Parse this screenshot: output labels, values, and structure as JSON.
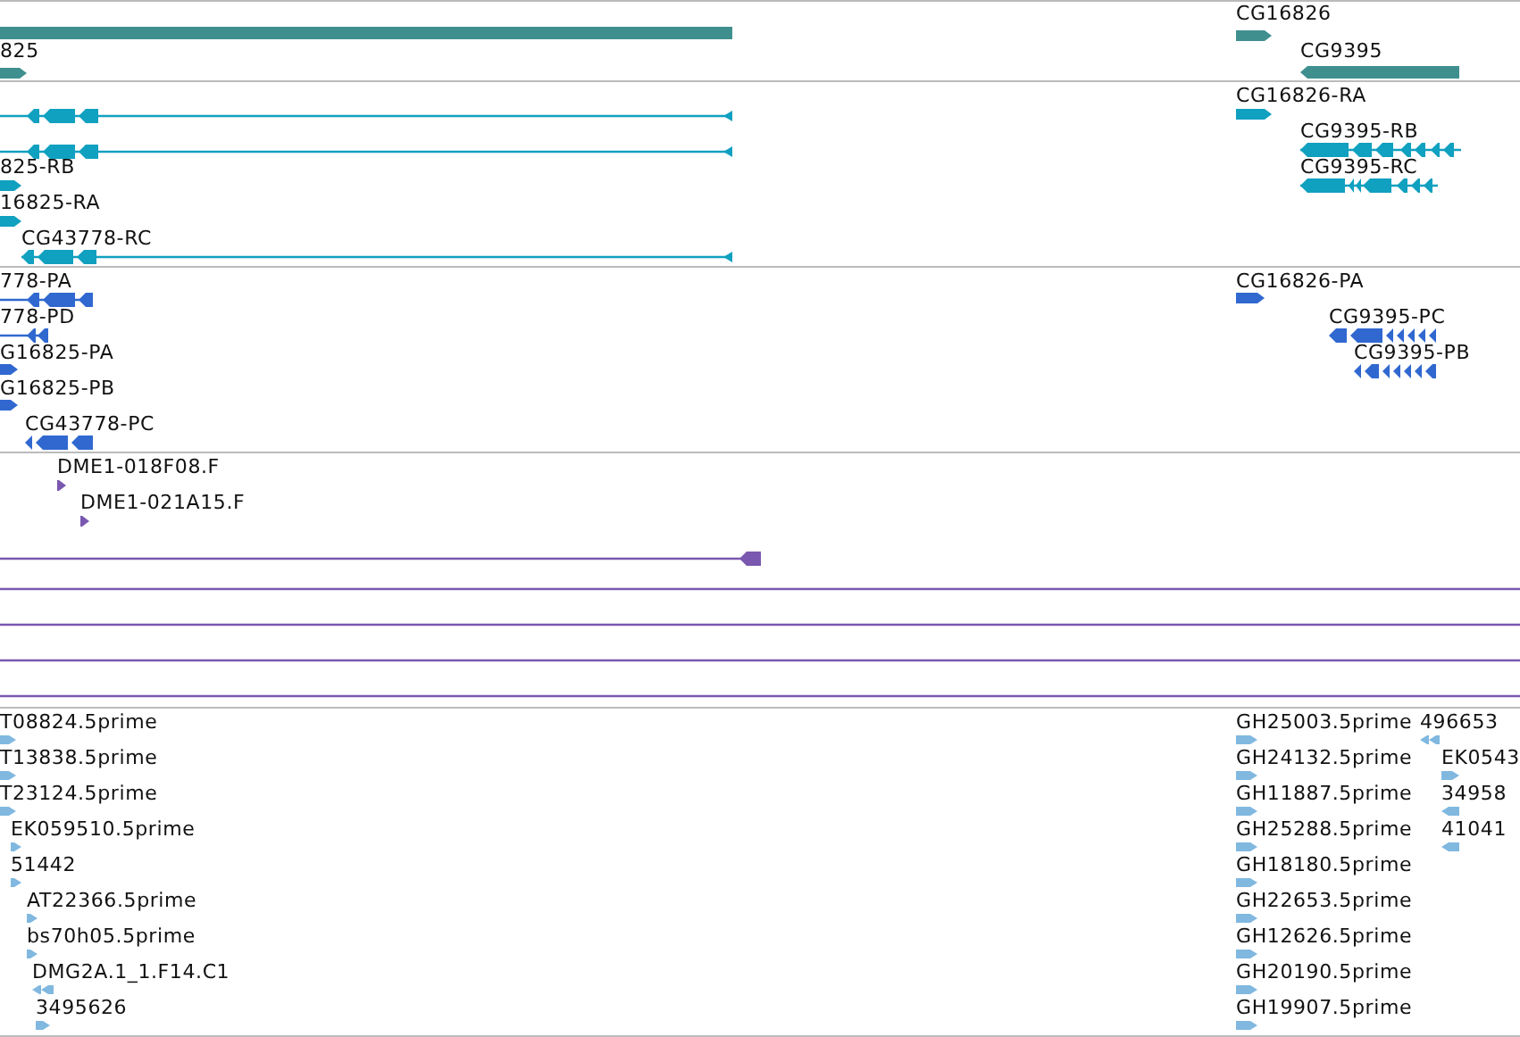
{
  "tracks": [
    {
      "color": "#3f8f8f",
      "features": [
        {
          "kind": "plain"
        },
        {
          "label": "825",
          "kind": "forward"
        },
        {
          "label": "CG16826",
          "kind": "forward"
        },
        {
          "label": "CG9395",
          "kind": "reverse"
        }
      ]
    },
    {
      "color": "#10a0c0",
      "features": [
        {
          "kind": "reverse"
        },
        {
          "kind": "reverse"
        },
        {
          "label": "825-RB",
          "kind": "forward"
        },
        {
          "label": "16825-RA",
          "kind": "forward"
        },
        {
          "label": "CG43778-RC",
          "kind": "reverse"
        },
        {
          "label": "CG16826-RA",
          "kind": "forward"
        },
        {
          "label": "CG9395-RB",
          "kind": "reverse"
        },
        {
          "label": "CG9395-RC",
          "kind": "reverse"
        }
      ]
    },
    {
      "color": "#3068d0",
      "features": [
        {
          "label": "778-PA",
          "kind": "reverse"
        },
        {
          "label": "778-PD",
          "kind": "reverse"
        },
        {
          "label": "G16825-PA",
          "kind": "forward"
        },
        {
          "label": "G16825-PB",
          "kind": "forward"
        },
        {
          "label": "CG43778-PC",
          "kind": "reverse"
        },
        {
          "label": "CG16826-PA",
          "kind": "forward"
        },
        {
          "label": "CG9395-PC",
          "kind": "reverse"
        },
        {
          "label": "CG9395-PB",
          "kind": "reverse"
        }
      ]
    },
    {
      "color": "#7a58b0",
      "features": [
        {
          "label": "DME1-018F08.F",
          "kind": "forward"
        },
        {
          "label": "DME1-021A15.F",
          "kind": "forward"
        },
        {
          "kind": "reverse"
        },
        {
          "kind": "plain"
        },
        {
          "kind": "plain"
        },
        {
          "kind": "plain"
        },
        {
          "kind": "plain"
        }
      ]
    },
    {
      "color": "#80b8e0",
      "features": [
        {
          "label": "T08824.5prime",
          "kind": "forward"
        },
        {
          "label": "T13838.5prime",
          "kind": "forward"
        },
        {
          "label": "T23124.5prime",
          "kind": "forward"
        },
        {
          "label": "EK059510.5prime",
          "kind": "forward"
        },
        {
          "label": "51442",
          "kind": "forward"
        },
        {
          "label": "AT22366.5prime",
          "kind": "forward"
        },
        {
          "label": "bs70h05.5prime",
          "kind": "forward"
        },
        {
          "label": "DMG2A.1_1.F14.C1",
          "kind": "reverse"
        },
        {
          "label": "3495626",
          "kind": "forward"
        },
        {
          "label": "GH25003.5prime",
          "kind": "forward"
        },
        {
          "label": "496653",
          "kind": "reverse"
        },
        {
          "label": "GH24132.5prime",
          "kind": "forward"
        },
        {
          "label": "EK0543",
          "kind": "forward"
        },
        {
          "label": "GH11887.5prime",
          "kind": "forward"
        },
        {
          "label": "34958",
          "kind": "reverse"
        },
        {
          "label": "GH25288.5prime",
          "kind": "forward"
        },
        {
          "label": "41041",
          "kind": "reverse"
        },
        {
          "label": "GH18180.5prime",
          "kind": "forward"
        },
        {
          "label": "GH22653.5prime",
          "kind": "forward"
        },
        {
          "label": "GH12626.5prime",
          "kind": "forward"
        },
        {
          "label": "GH20190.5prime",
          "kind": "forward"
        },
        {
          "label": "GH19907.5prime",
          "kind": "forward"
        }
      ]
    }
  ]
}
